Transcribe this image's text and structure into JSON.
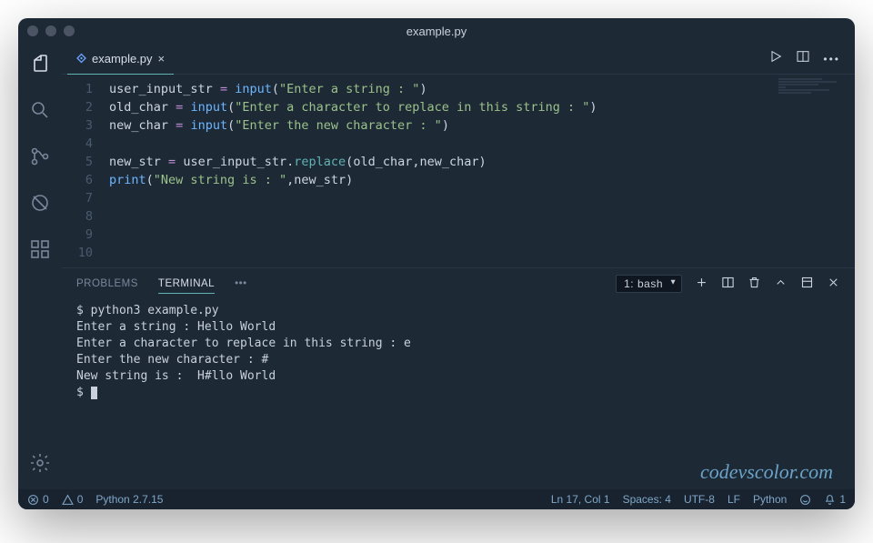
{
  "window": {
    "title": "example.py"
  },
  "tab": {
    "filename": "example.py",
    "close": "×"
  },
  "code": {
    "lines": [
      {
        "n": "1",
        "html": "<span class='tk-var'>user_input_str</span> <span class='tk-op'>=</span> <span class='tk-fn'>input</span><span class='tk-p'>(</span><span class='tk-str'>\"Enter a string : \"</span><span class='tk-p'>)</span>"
      },
      {
        "n": "2",
        "html": "<span class='tk-var'>old_char</span> <span class='tk-op'>=</span> <span class='tk-fn'>input</span><span class='tk-p'>(</span><span class='tk-str'>\"Enter a character to replace in this string : \"</span><span class='tk-p'>)</span>"
      },
      {
        "n": "3",
        "html": "<span class='tk-var'>new_char</span> <span class='tk-op'>=</span> <span class='tk-fn'>input</span><span class='tk-p'>(</span><span class='tk-str'>\"Enter the new character : \"</span><span class='tk-p'>)</span>"
      },
      {
        "n": "4",
        "html": ""
      },
      {
        "n": "5",
        "html": "<span class='tk-var'>new_str</span> <span class='tk-op'>=</span> <span class='tk-var'>user_input_str</span><span class='tk-p'>.</span><span class='tk-fn2'>replace</span><span class='tk-p'>(</span><span class='tk-var'>old_char</span><span class='tk-p'>,</span><span class='tk-var'>new_char</span><span class='tk-p'>)</span>"
      },
      {
        "n": "6",
        "html": "<span class='tk-fn'>print</span><span class='tk-p'>(</span><span class='tk-str'>\"New string is : \"</span><span class='tk-p'>,</span><span class='tk-var'>new_str</span><span class='tk-p'>)</span>"
      },
      {
        "n": "7",
        "html": ""
      },
      {
        "n": "8",
        "html": ""
      },
      {
        "n": "9",
        "html": ""
      },
      {
        "n": "10",
        "html": ""
      }
    ]
  },
  "panel": {
    "tabs": {
      "problems": "PROBLEMS",
      "terminal": "TERMINAL",
      "more": "•••"
    },
    "termSelect": "1: bash"
  },
  "terminal": {
    "lines": [
      "$ python3 example.py",
      "Enter a string : Hello World",
      "Enter a character to replace in this string : e",
      "Enter the new character : #",
      "New string is :  H#llo World",
      "$ "
    ]
  },
  "watermark": "codevscolor.com",
  "status": {
    "errors": "0",
    "warnings": "0",
    "python": "Python 2.7.15",
    "pos": "Ln 17, Col 1",
    "spaces": "Spaces: 4",
    "encoding": "UTF-8",
    "eol": "LF",
    "lang": "Python",
    "bell": "1"
  }
}
